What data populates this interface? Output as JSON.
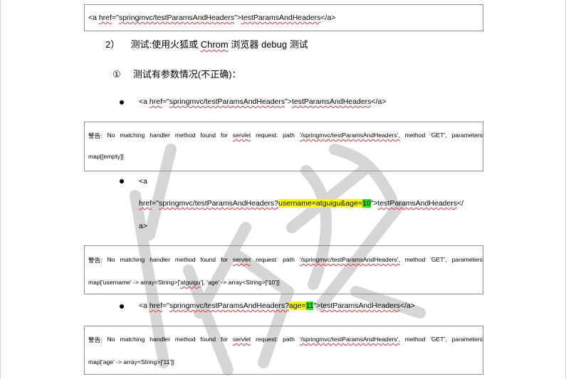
{
  "box1": {
    "tag_open": "<a ",
    "href_kw": "href",
    "eq_q": "=\"",
    "href_val": "springmvc/testParamsAndHeaders",
    "close_q": "\">",
    "link_text": "testParamsAndHeaders",
    "tag_close": "</a>"
  },
  "heading2": {
    "number": "2）",
    "text_a": "测试:使用火狐或 ",
    "chrom": "Chrom",
    "text_b": " 浏览器 debug 测试"
  },
  "heading3": {
    "number": "①",
    "text": "测试有参数情况(不正确)："
  },
  "bullet1": {
    "tag_open": "<a ",
    "href_kw": "href",
    "eq_q": "=\"",
    "href_val": "springmvc/testParamsAndHeaders",
    "close_q": "\">",
    "link_text": "testParamsAndHeaders",
    "tag_close": "</a>"
  },
  "warn1": {
    "words": [
      "警告:",
      "No",
      "matching",
      "handler",
      "method",
      "found",
      "for",
      "servlet",
      "request:",
      "path",
      "'/springmvc/testParamsAndHeaders',",
      "method",
      "'GET',",
      "parameters"
    ],
    "line2": "map[[empty]]"
  },
  "bullet2": {
    "line1": "<a",
    "href_kw": "href",
    "eq_q": "=\"",
    "href_val": "springmvc/testParamsAndHeaders?",
    "param_yellow": "username=atguigu&age=",
    "param_green": "10",
    "close_q": "\">",
    "link_text": "testParamsAndHeaders",
    "tail": "</",
    "line3": "a>"
  },
  "warn2": {
    "words": [
      "警告:",
      "No",
      "matching",
      "handler",
      "method",
      "found",
      "for",
      "servlet",
      "request:",
      "path",
      "'/springmvc/testParamsAndHeaders',",
      "method",
      "'GET',",
      "parameters"
    ],
    "line2_a": "map['username' -> array<String>['",
    "line2_b": "atguigu",
    "line2_c": "'], 'age' -> array<String>['10']]"
  },
  "bullet3": {
    "tag_open": "<a ",
    "href_kw": "href",
    "eq_q": "=\"",
    "href_val": "springmvc/testParamsAndHeaders?",
    "param_yellow": "age=",
    "param_green": "11",
    "close_q": "\">",
    "link_text": "testParamsAndHeaders",
    "tag_close": "</a>"
  },
  "warn3": {
    "words": [
      "警告:",
      "No",
      "matching",
      "handler",
      "method",
      "found",
      "for",
      "servlet",
      "request:",
      "path",
      "'/springmvc/testParamsAndHeaders',",
      "method",
      "'GET',",
      "parameters"
    ],
    "line2": "map['age' -> array<String>['11']]"
  },
  "colors": {
    "highlight_yellow": "#ffff00",
    "highlight_green": "#22e022",
    "spell_squiggle": "#e0343a",
    "box_border": "#8c8c8c"
  }
}
